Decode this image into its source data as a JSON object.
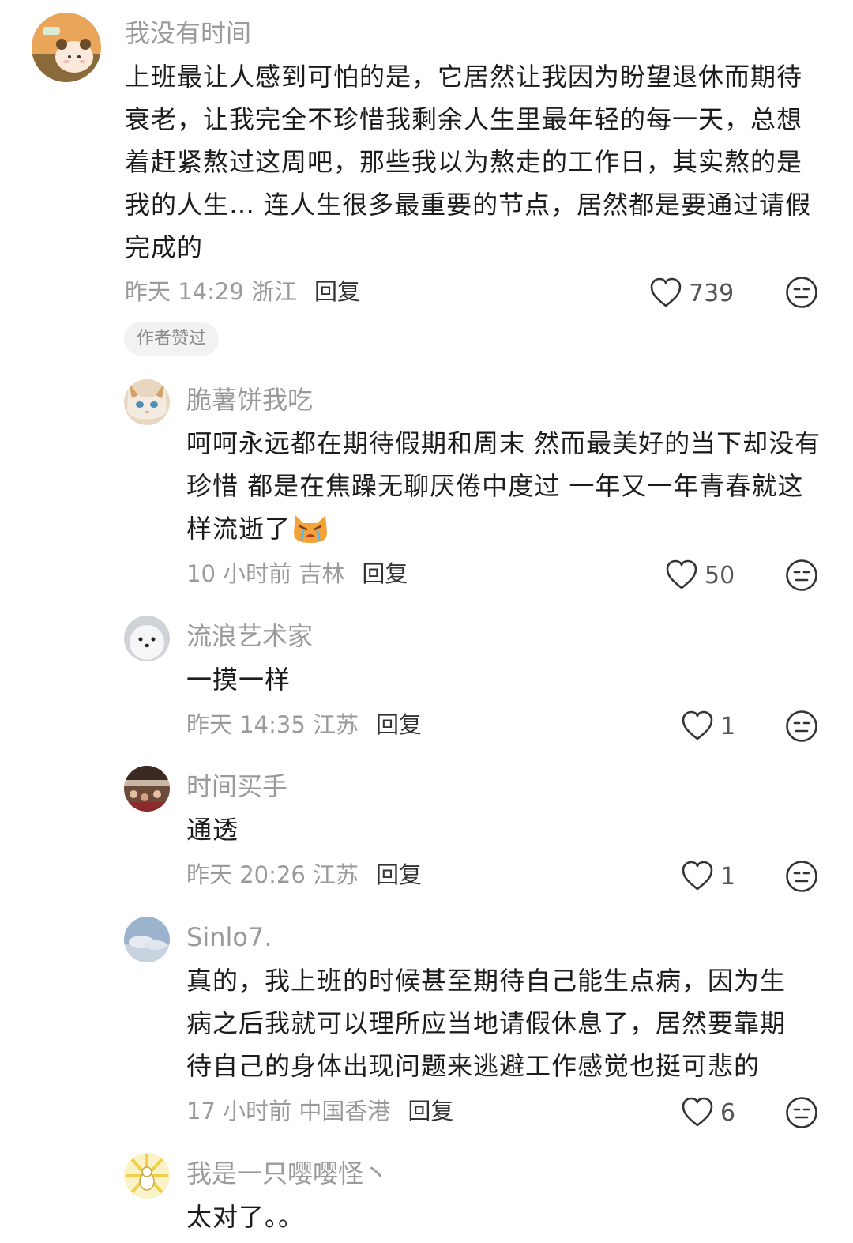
{
  "author_badge": "作者赞过",
  "comments": [
    {
      "username": "我没有时间",
      "text": "上班最让人感到可怕的是，它居然让我因为盼望退休而期待衰老，让我完全不珍惜我剩余人生里最年轻的每一天，总想着赶紧熬过这周吧，那些我以为熬走的工作日，其实熬的是我的人生… 连人生很多最重要的节点，居然都是要通过请假完成的",
      "time": "昨天 14:29 浙江",
      "reply": "回复",
      "likes": "739"
    },
    {
      "username": "脆薯饼我吃",
      "text": "呵呵永远都在期待假期和周末 然而最美好的当下却没有珍惜 都是在焦躁无聊厌倦中度过 一年又一年青春就这样流逝了",
      "time": "10 小时前 吉林",
      "reply": "回复",
      "likes": "50",
      "emoji": "crying-cat-emoji"
    },
    {
      "username": "流浪艺术家",
      "text": "一摸一样",
      "time": "昨天 14:35 江苏",
      "reply": "回复",
      "likes": "1"
    },
    {
      "username": "时间买手",
      "text": "通透",
      "time": "昨天 20:26 江苏",
      "reply": "回复",
      "likes": "1"
    },
    {
      "username": "Sinlo7.",
      "text": "真的，我上班的时候甚至期待自己能生点病，因为生病之后我就可以理所应当地请假休息了，居然要靠期待自己的身体出现问题来逃避工作感觉也挺可悲的",
      "time": "17 小时前 中国香港",
      "reply": "回复",
      "likes": "6"
    },
    {
      "username": "我是一只嘤嘤怪丶",
      "text": "太对了。。"
    }
  ],
  "icons": {
    "like": "heart-outline-icon",
    "reaction": "neutral-face-icon"
  }
}
